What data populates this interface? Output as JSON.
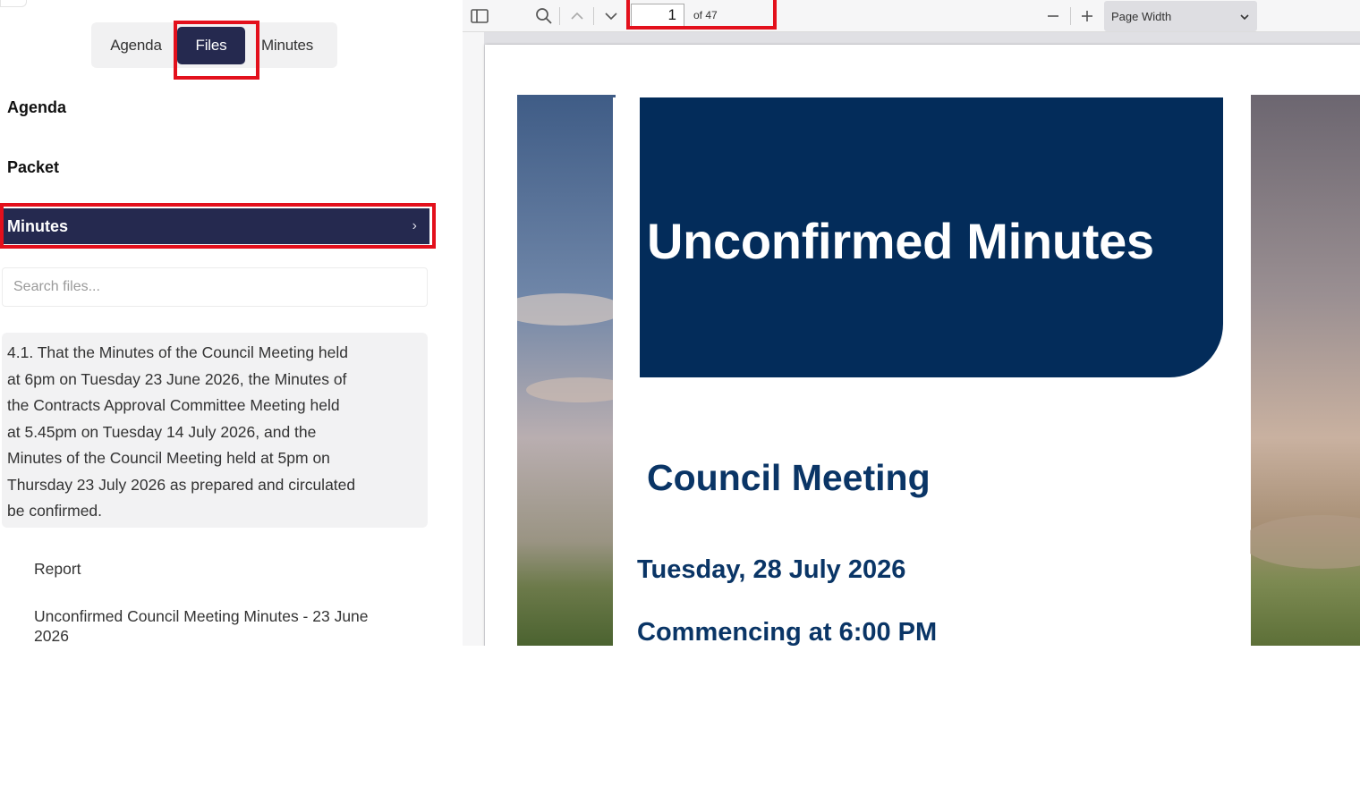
{
  "sidebar": {
    "tabs": [
      {
        "label": "Agenda"
      },
      {
        "label": "Files"
      },
      {
        "label": "Minutes"
      }
    ],
    "sections": [
      {
        "label": "Agenda"
      },
      {
        "label": "Packet"
      },
      {
        "label": "Minutes"
      }
    ],
    "search": {
      "placeholder": "Search files..."
    },
    "resolution_lines": [
      "4.1. That the Minutes of the Council Meeting held",
      "at 6pm on Tuesday 23 June 2026, the Minutes of",
      "the Contracts Approval Committee Meeting held",
      "at 5.45pm on Tuesday 14 July 2026, and the",
      "Minutes of the Council Meeting held at 5pm on",
      "Thursday 23 July 2026 as prepared and circulated",
      "be confirmed."
    ],
    "files": [
      {
        "label": "Report"
      },
      {
        "line1": "Unconfirmed Council Meeting Minutes - 23 June",
        "line2": "2026"
      }
    ]
  },
  "viewer": {
    "page_number": "1",
    "page_of": "of 47",
    "zoom": "Page Width"
  },
  "document": {
    "title": "Unconfirmed Minutes",
    "subtitle": "Council Meeting",
    "date": "Tuesday, 28 July 2026",
    "time": "Commencing at 6:00 PM"
  },
  "colors": {
    "accent": "#25294f",
    "highlight": "#e3101c",
    "doc_banner": "#032c5a",
    "doc_text": "#0a3566"
  }
}
